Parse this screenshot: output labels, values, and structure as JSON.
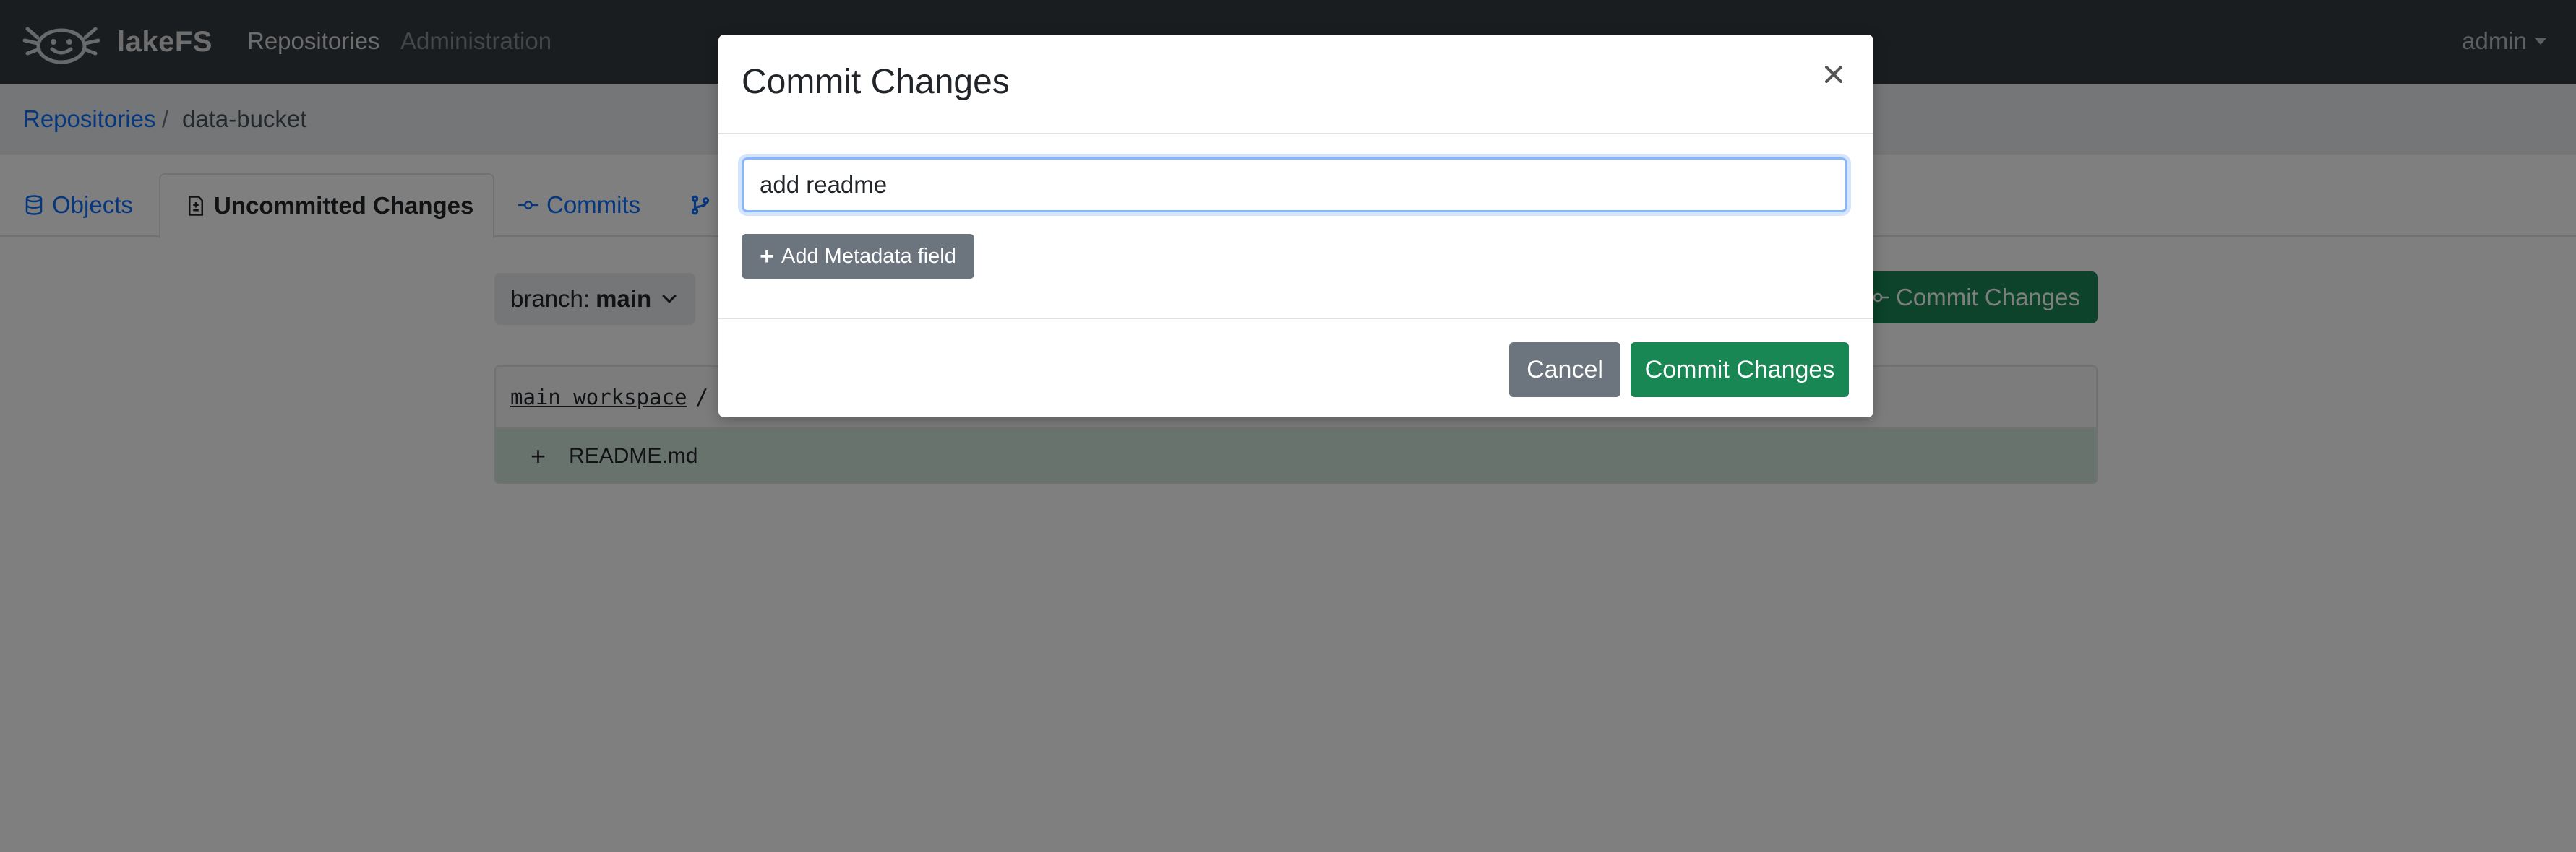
{
  "navbar": {
    "brand": "lakeFS",
    "logo_icon": "axolotl-logo-icon",
    "links": [
      "Repositories",
      "Administration"
    ],
    "user": "admin"
  },
  "breadcrumb": {
    "root": "Repositories",
    "separator": "/",
    "current": "data-bucket"
  },
  "tabs": {
    "objects": "Objects",
    "uncommitted": "Uncommitted Changes",
    "commits": "Commits",
    "branches_icon": "branch-icon"
  },
  "main": {
    "branch_prefix": "branch:",
    "branch_name": "main",
    "commit_button": "Commit Changes",
    "changes": {
      "workspace": "main workspace",
      "separator": "/",
      "rows": [
        {
          "status": "+",
          "path": "README.md"
        }
      ]
    }
  },
  "modal": {
    "title": "Commit Changes",
    "close_label": "×",
    "message_value": "add readme",
    "add_metadata_label": "Add Metadata field",
    "cancel_label": "Cancel",
    "commit_label": "Commit Changes"
  },
  "colors": {
    "primary": "#0d6efd",
    "success": "#198754",
    "secondary": "#6c757d",
    "navbar": "#343a40",
    "added_row": "#d1e7dd"
  }
}
